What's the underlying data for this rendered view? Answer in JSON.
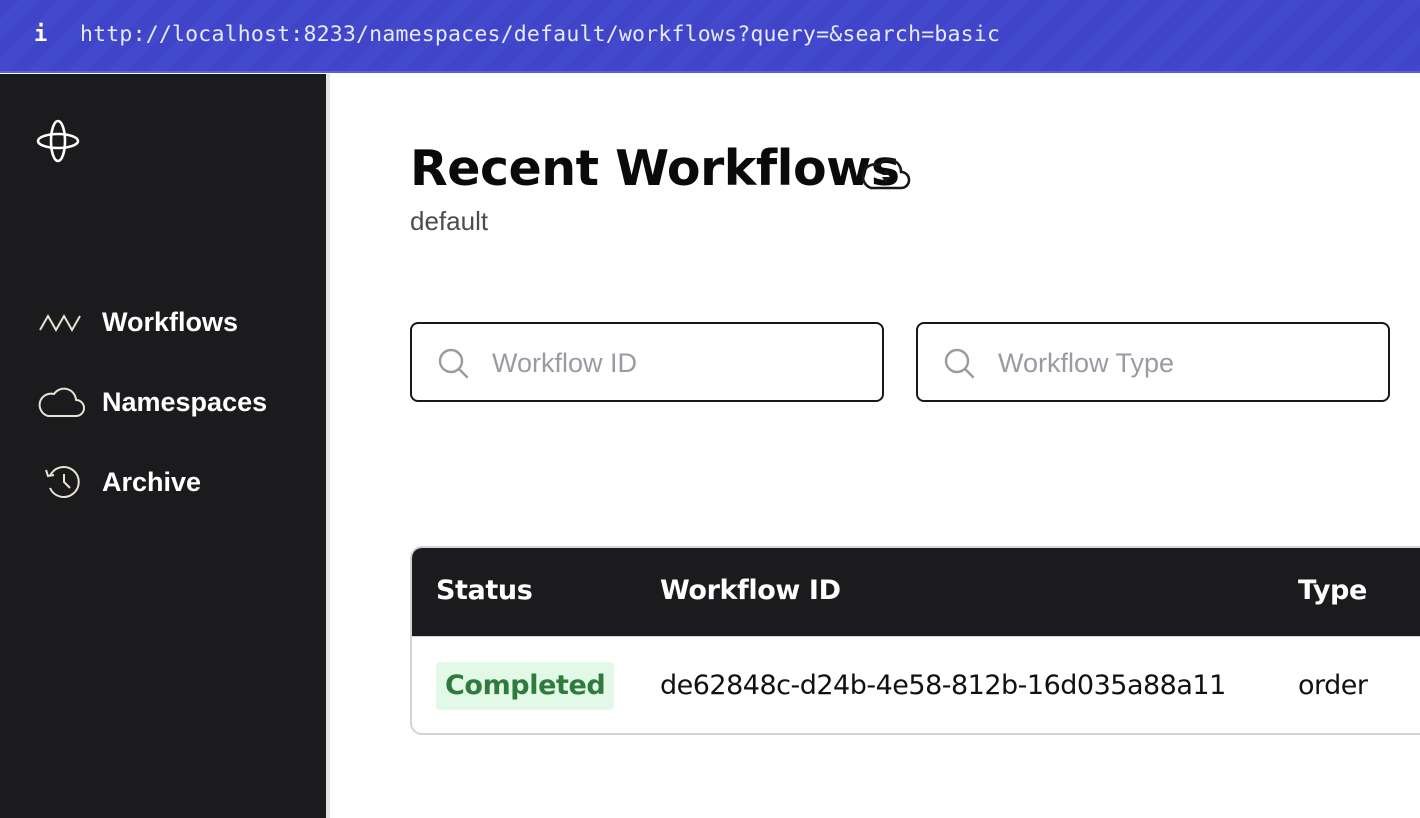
{
  "browser": {
    "info_icon": "info-icon",
    "url": "http://localhost:8233/namespaces/default/workflows?query=&search=basic"
  },
  "sidebar": {
    "logo": "temporal-logo",
    "items": [
      {
        "label": "Workflows",
        "icon": "workflows-zigzag-icon"
      },
      {
        "label": "Namespaces",
        "icon": "cloud-icon"
      },
      {
        "label": "Archive",
        "icon": "history-icon"
      }
    ]
  },
  "header": {
    "title": "Recent Workflows",
    "title_icon": "cloud-sort-icon",
    "namespace": "default"
  },
  "filters": {
    "workflow_id": {
      "value": "",
      "placeholder": "Workflow ID",
      "icon": "search-icon"
    },
    "workflow_type": {
      "value": "",
      "placeholder": "Workflow Type",
      "icon": "search-icon"
    }
  },
  "table": {
    "columns": [
      "Status",
      "Workflow ID",
      "Type"
    ],
    "rows": [
      {
        "status": "Completed",
        "workflow_id": "de62848c-d24b-4e58-812b-16d035a88a11",
        "type": "order"
      }
    ]
  },
  "colors": {
    "url_bar": "#3f44c9",
    "sidebar": "#1b1b1d",
    "status_completed_bg": "#e1f9e6",
    "status_completed_text": "#2f7a3c"
  }
}
